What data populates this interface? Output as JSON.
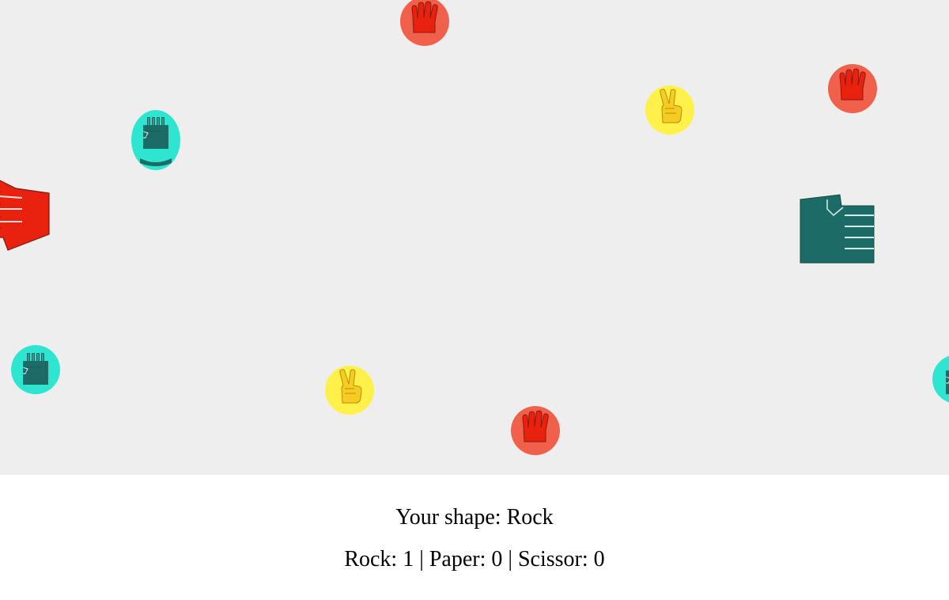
{
  "colors": {
    "arena_bg": "#eeeeee",
    "rock_circle": "#2ee6cf",
    "rock_fist": "#1c6b66",
    "paper_circle": "#f0604a",
    "paper_hand": "#e8220f",
    "scissor_circle": "#fff04a",
    "scissor_hand": "#f6cc22"
  },
  "game": {
    "players": [
      {
        "shape": "paper",
        "icon": "paper-hand-icon"
      },
      {
        "shape": "paper",
        "icon": "paper-hand-icon"
      },
      {
        "shape": "paper",
        "icon": "paper-hand-icon"
      },
      {
        "shape": "scissor",
        "icon": "scissor-hand-icon"
      },
      {
        "shape": "scissor",
        "icon": "scissor-hand-icon"
      },
      {
        "shape": "rock",
        "icon": "rock-fist-icon"
      },
      {
        "shape": "rock",
        "icon": "rock-fist-icon"
      },
      {
        "shape": "rock",
        "icon": "rock-fist-icon"
      },
      {
        "shape": "paper",
        "icon": "paper-hand-icon",
        "uncircled": true
      },
      {
        "shape": "rock",
        "icon": "rock-fist-icon",
        "uncircled": true
      }
    ]
  },
  "hud": {
    "shape_label": "Your shape:",
    "shape_value": "Rock",
    "rock_label": "Rock:",
    "rock_count": "1",
    "paper_label": "Paper:",
    "paper_count": "0",
    "scissor_label": "Scissor:",
    "scissor_count": "0",
    "separator": "|"
  }
}
